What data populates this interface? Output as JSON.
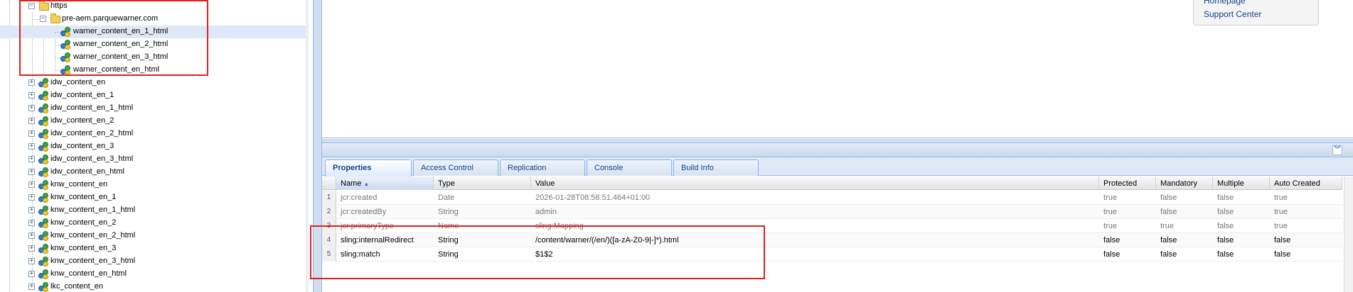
{
  "tree": {
    "rows": [
      {
        "label": "https",
        "icon": "folder-icon",
        "expanded": true
      },
      {
        "label": "pre-aem.parquewarner.com",
        "icon": "folder-icon",
        "expanded": true
      },
      {
        "label": "warner_content_en_1_html",
        "icon": "node-icon",
        "selected": true
      },
      {
        "label": "warner_content_en_2_html",
        "icon": "node-icon"
      },
      {
        "label": "warner_content_en_3_html",
        "icon": "node-icon"
      },
      {
        "label": "warner_content_en_html",
        "icon": "node-icon"
      },
      {
        "label": "idw_content_en",
        "icon": "node-icon"
      },
      {
        "label": "idw_content_en_1",
        "icon": "node-icon"
      },
      {
        "label": "idw_content_en_1_html",
        "icon": "node-icon"
      },
      {
        "label": "idw_content_en_2",
        "icon": "node-icon"
      },
      {
        "label": "idw_content_en_2_html",
        "icon": "node-icon"
      },
      {
        "label": "idw_content_en_3",
        "icon": "node-icon"
      },
      {
        "label": "idw_content_en_3_html",
        "icon": "node-icon"
      },
      {
        "label": "idw_content_en_html",
        "icon": "node-icon"
      },
      {
        "label": "knw_content_en",
        "icon": "node-icon"
      },
      {
        "label": "knw_content_en_1",
        "icon": "node-icon"
      },
      {
        "label": "knw_content_en_1_html",
        "icon": "node-icon"
      },
      {
        "label": "knw_content_en_2",
        "icon": "node-icon"
      },
      {
        "label": "knw_content_en_2_html",
        "icon": "node-icon"
      },
      {
        "label": "knw_content_en_3",
        "icon": "node-icon"
      },
      {
        "label": "knw_content_en_3_html",
        "icon": "node-icon"
      },
      {
        "label": "knw_content_en_html",
        "icon": "node-icon"
      },
      {
        "label": "lkc_content_en",
        "icon": "node-icon"
      }
    ]
  },
  "side_panel": {
    "links": [
      "Homepage",
      "Support Center"
    ]
  },
  "tabs": [
    {
      "label": "Properties",
      "active": true
    },
    {
      "label": "Access Control"
    },
    {
      "label": "Replication"
    },
    {
      "label": "Console"
    },
    {
      "label": "Build Info"
    }
  ],
  "grid": {
    "columns": [
      "Name",
      "Type",
      "Value",
      "Protected",
      "Mandatory",
      "Multiple",
      "Auto Created"
    ],
    "sorted_column": "Name",
    "rows": [
      {
        "num": "1",
        "name": "jcr:created",
        "type": "Date",
        "value": "2026-01-28T08:58:51.464+01:00",
        "protected": "true",
        "mandatory": "false",
        "multiple": "false",
        "auto_created": "true",
        "system": true
      },
      {
        "num": "2",
        "name": "jcr:createdBy",
        "type": "String",
        "value": "admin",
        "protected": "true",
        "mandatory": "false",
        "multiple": "false",
        "auto_created": "true",
        "system": true
      },
      {
        "num": "3",
        "name": "jcr:primaryType",
        "type": "Name",
        "value": "sling:Mapping",
        "protected": "true",
        "mandatory": "true",
        "multiple": "false",
        "auto_created": "true",
        "system": true
      },
      {
        "num": "4",
        "name": "sling:internalRedirect",
        "type": "String",
        "value": "/content/warner/(/en/)([a-zA-Z0-9|-]*).html",
        "protected": "false",
        "mandatory": "false",
        "multiple": "false",
        "auto_created": "false",
        "system": false
      },
      {
        "num": "5",
        "name": "sling:match",
        "type": "String",
        "value": "$1$2",
        "protected": "false",
        "mandatory": "false",
        "multiple": "false",
        "auto_created": "false",
        "system": false
      }
    ]
  },
  "colors": {
    "highlight": "#e02020",
    "selected_row": "#dfe8f6",
    "accent": "#15428b"
  }
}
